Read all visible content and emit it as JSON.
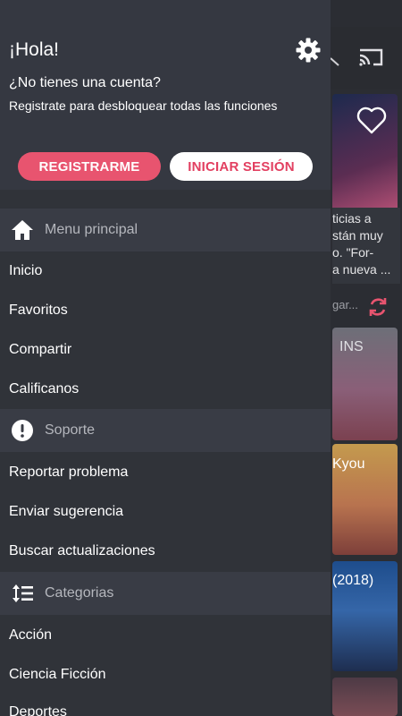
{
  "background": {
    "card1_text": [
      "ticias a",
      "stán muy",
      "o. \"For-",
      "a nueva ..."
    ],
    "row_text": "gar...",
    "card2_label": "INS",
    "card3_label": "Kyou",
    "card4_label": "(2018)",
    "accent": "#e8546f"
  },
  "drawer": {
    "greeting": "¡Hola!",
    "no_account": "¿No tienes una cuenta?",
    "register_hint": "Registrate para desbloquear todas las funciones",
    "register_button": "REGISTRARME",
    "login_button": "INICIAR SESIÓN",
    "sections": {
      "main": {
        "label": "Menu principal",
        "icon": "home-icon",
        "items": [
          "Inicio",
          "Favoritos",
          "Compartir",
          "Calificanos"
        ]
      },
      "support": {
        "label": "Soporte",
        "icon": "alert-icon",
        "items": [
          "Reportar problema",
          "Enviar sugerencia",
          "Buscar actualizaciones"
        ]
      },
      "categories": {
        "label": "Categorias",
        "icon": "sort-icon",
        "items": [
          "Acción",
          "Ciencia Ficción",
          "Deportes"
        ]
      }
    }
  }
}
